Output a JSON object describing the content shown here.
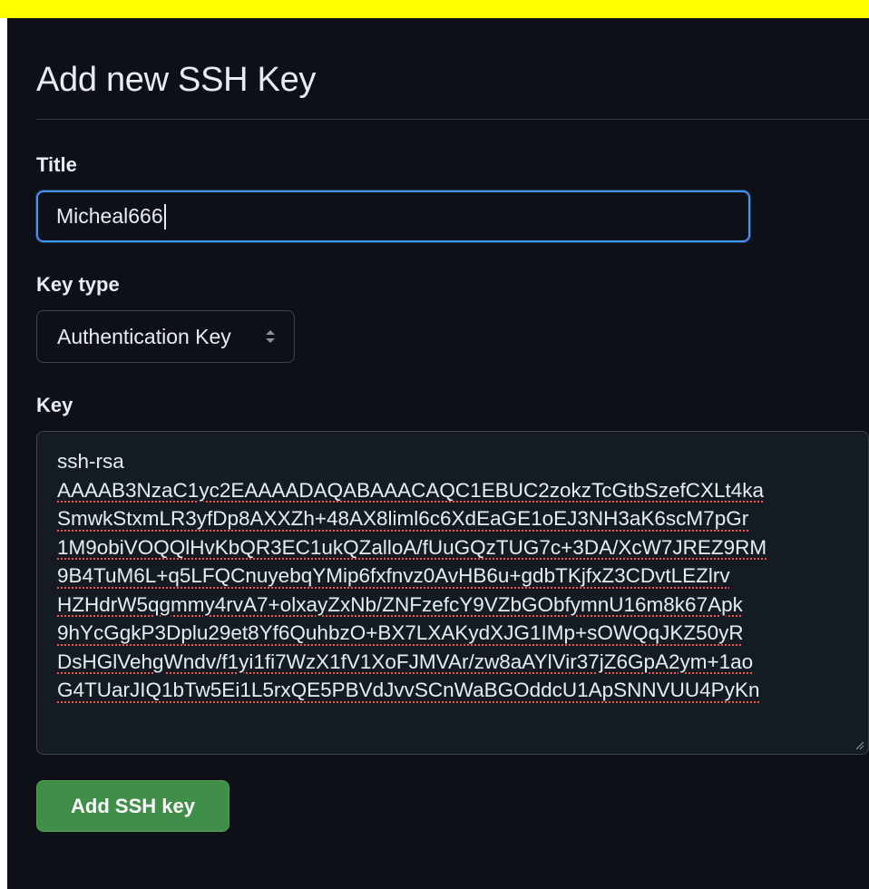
{
  "page": {
    "title": "Add new SSH Key"
  },
  "form": {
    "title_label": "Title",
    "title_value": "Micheal666",
    "key_type_label": "Key type",
    "key_type_selected": "Authentication Key",
    "key_label": "Key",
    "key_lines": [
      "ssh-rsa",
      "AAAAB3NzaC1yc2EAAAADAQABAAACAQC1EBUC2zokzTcGtbSzefCXLt4ka",
      "SmwkStxmLR3yfDp8AXXZh+48AX8liml6c6XdEaGE1oEJ3NH3aK6scM7pGr",
      "1M9obiVOQQlHvKbQR3EC1ukQZalloA/fUuGQzTUG7c+3DA/XcW7JREZ9RM",
      "9B4TuM6L+q5LFQCnuyebqYMip6fxfnvz0AvHB6u+gdbTKjfxZ3CDvtLEZlrv",
      "HZHdrW5qgmmy4rvA7+olxayZxNb/ZNFzefcY9VZbGObfymnU16m8k67Apk",
      "9hYcGgkP3Dplu29et8Yf6QuhbzO+BX7LXAKydXJG1IMp+sOWQqJKZ50yR",
      "DsHGlVehgWndv/f1yi1fi7WzX1fV1XoFJMVAr/zw8aAYlVir37jZ6GpA2ym+1ao",
      "G4TUarJIQ1bTw5Ei1L5rxQE5PBVdJvvSCnWaBGOddcU1ApSNNVUU4PyKn"
    ],
    "submit_label": "Add SSH key"
  },
  "icons": {
    "select_arrows": "chevron-up-down-icon",
    "resize": "resize-handle-icon"
  },
  "colors": {
    "banner": "#ffff00",
    "background": "#0d1117",
    "text": "#e6edf3",
    "focus_border": "#4493f8",
    "primary_button": "#3f8f48",
    "spellcheck": "#f85149"
  }
}
